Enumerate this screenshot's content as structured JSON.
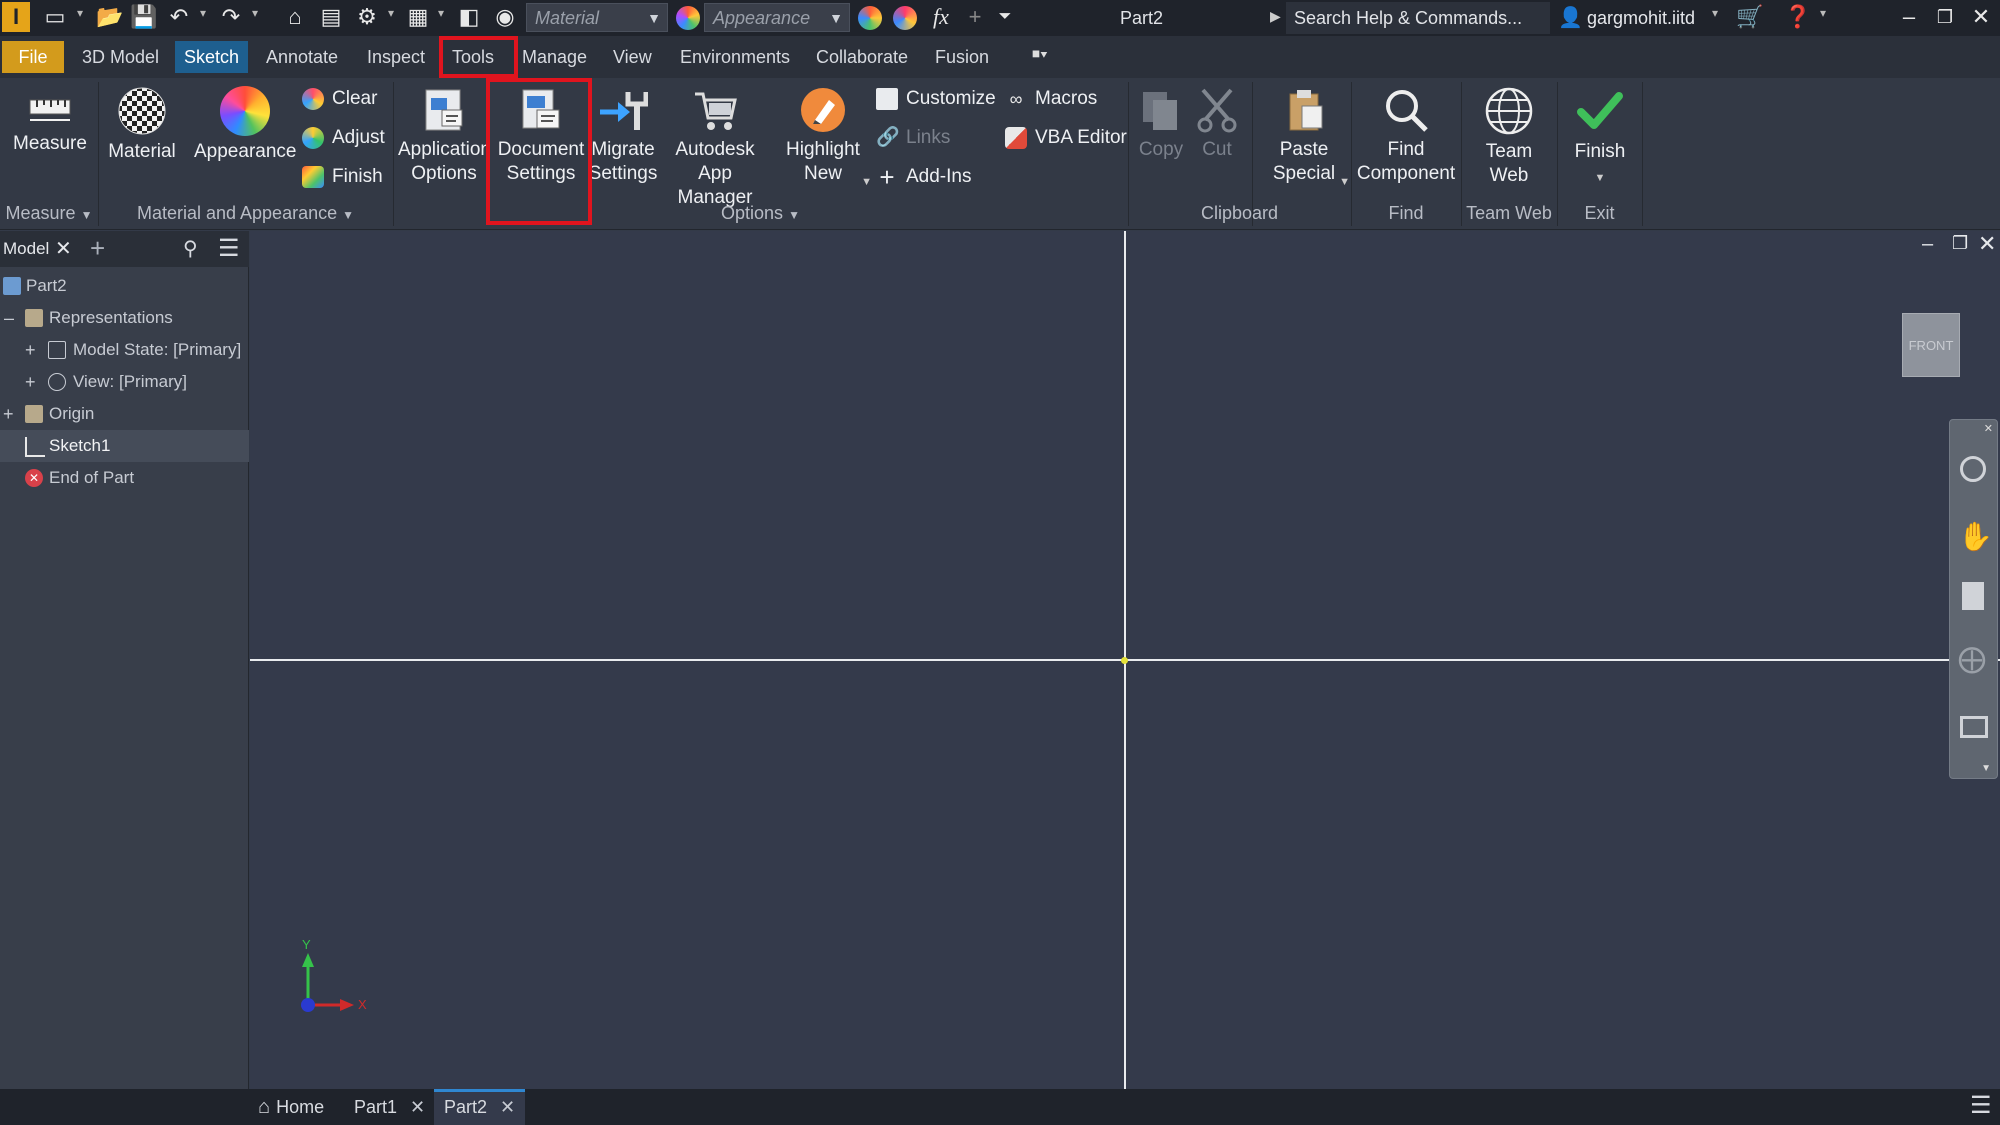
{
  "titlebar": {
    "material_placeholder": "Material",
    "appearance_placeholder": "Appearance",
    "document_title": "Part2",
    "search_placeholder": "Search Help & Commands...",
    "username": "gargmohit.iitd"
  },
  "tabs": [
    "File",
    "3D Model",
    "Sketch",
    "Annotate",
    "Inspect",
    "Tools",
    "Manage",
    "View",
    "Environments",
    "Collaborate",
    "Fusion"
  ],
  "ribbon": {
    "measure": "Measure",
    "material": "Material",
    "appearance": "Appearance",
    "clear": "Clear",
    "adjust": "Adjust",
    "finish_small": "Finish",
    "application_options": [
      "Application",
      "Options"
    ],
    "document_settings": [
      "Document",
      "Settings"
    ],
    "migrate_settings": [
      "Migrate",
      "Settings"
    ],
    "app_manager": [
      "Autodesk",
      "App Manager"
    ],
    "highlight_new": [
      "Highlight",
      "New"
    ],
    "customize": "Customize",
    "links": "Links",
    "add_ins": "Add-Ins",
    "macros": "Macros",
    "vba_editor": "VBA Editor",
    "copy": "Copy",
    "cut": "Cut",
    "paste_special": [
      "Paste",
      "Special"
    ],
    "find_component": [
      "Find",
      "Component"
    ],
    "team_web": "Team Web",
    "finish": "Finish",
    "panels": {
      "measure": "Measure",
      "material_appearance": "Material and Appearance",
      "options": "Options",
      "clipboard": "Clipboard",
      "find": "Find",
      "team_web": "Team Web",
      "exit": "Exit"
    }
  },
  "browser": {
    "tab_label": "Model",
    "items": [
      "Part2",
      "Representations",
      "Model State: [Primary]",
      "View: [Primary]",
      "Origin",
      "Sketch1",
      "End of Part"
    ]
  },
  "viewcube": {
    "label": "FRONT"
  },
  "axes": {
    "x": "X",
    "y": "Y"
  },
  "document_tabs": [
    "Home",
    "Part1",
    "Part2"
  ],
  "colors": {
    "highlight_box": "#e0141e",
    "active_tab": "#1e5f8f",
    "file_tab": "#d39b1c"
  }
}
